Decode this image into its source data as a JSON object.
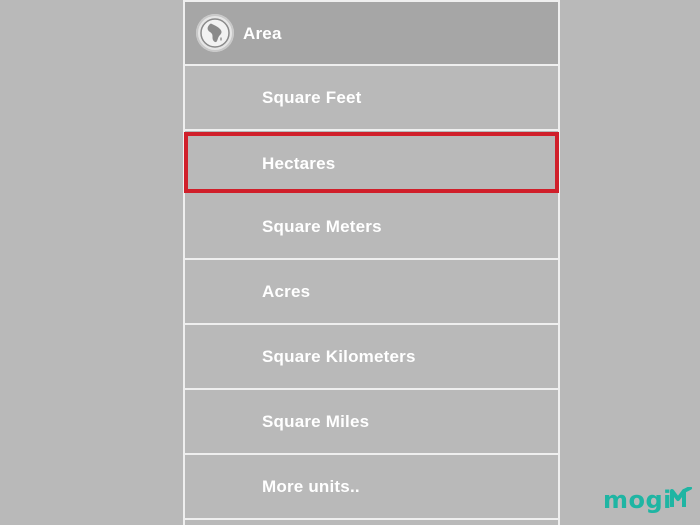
{
  "header": {
    "title": "Area",
    "icon": "globe-africa-icon"
  },
  "units": [
    {
      "label": "Square Feet"
    },
    {
      "label": "Hectares",
      "highlighted": true
    },
    {
      "label": "Square Meters"
    },
    {
      "label": "Acres"
    },
    {
      "label": "Square Kilometers"
    },
    {
      "label": "Square Miles"
    },
    {
      "label": "More units.."
    }
  ],
  "watermark": {
    "text": "mogi",
    "color": "#1fb5a3"
  },
  "colors": {
    "highlight": "#d01f2a",
    "background": "#b9b9b9",
    "header": "#a6a6a6"
  }
}
